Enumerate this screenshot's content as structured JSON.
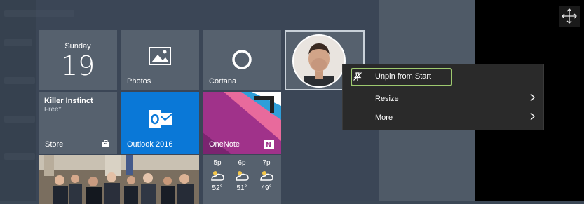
{
  "tiles": {
    "calendar": {
      "day_name": "Sunday",
      "day_number": "19"
    },
    "photos": {
      "label": "Photos"
    },
    "cortana": {
      "label": "Cortana"
    },
    "killer_instinct": {
      "title": "Killer Instinct",
      "subtitle": "Free*",
      "label": "Store"
    },
    "outlook": {
      "label": "Outlook 2016"
    },
    "onenote": {
      "label": "OneNote"
    },
    "weather": {
      "hours": [
        "5p",
        "6p",
        "7p"
      ],
      "temps": [
        "52°",
        "51°",
        "49°"
      ]
    }
  },
  "context_menu": {
    "unpin": "Unpin from Start",
    "resize": "Resize",
    "more": "More"
  },
  "icons": {
    "move": "move-icon",
    "unpin": "unpin-icon",
    "chevron": "chevron-right-icon"
  },
  "colors": {
    "tile": "#56616e",
    "outlook": "#0a78d7",
    "onenote": "#a0328a",
    "focus_ring": "#9ec96f",
    "menu_bg": "#2a2a2a"
  }
}
